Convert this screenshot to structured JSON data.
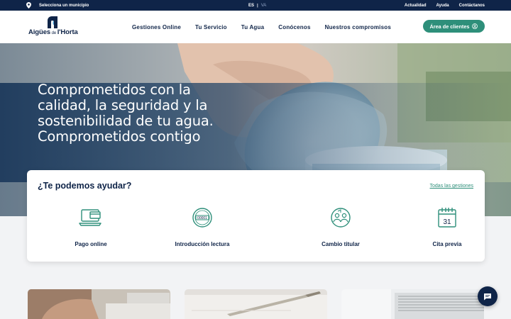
{
  "topbar": {
    "municipio": "Selecciona un municipio",
    "lang_active": "ES",
    "lang_separator": "|",
    "lang_other": "VA",
    "links": [
      "Actualidad",
      "Ayuda",
      "Contáctanos"
    ]
  },
  "logo": {
    "brand_main": "Aigües",
    "brand_small": " de ",
    "brand_end": "l'Horta"
  },
  "nav": [
    "Gestiones Online",
    "Tu Servicio",
    "Tu Agua",
    "Conócenos",
    "Nuestros compromisos"
  ],
  "client_button": "Área de clientes",
  "hero": {
    "lines": [
      "Comprometidos con la",
      "calidad, la seguridad y la",
      "sostenibilidad de tu agua.",
      "Comprometidos contigo"
    ]
  },
  "help": {
    "title": "¿Te podemos ayudar?",
    "all_link": "Todas las gestiones",
    "actions": [
      {
        "label": "Pago online",
        "icon": "laptop-card-icon"
      },
      {
        "label": "Introducción lectura",
        "icon": "water-meter-icon",
        "meter_text": "00001"
      },
      {
        "label": "Cambio titular",
        "icon": "user-switch-icon"
      },
      {
        "label": "Cita previa",
        "icon": "calendar-icon",
        "calendar_day": "31"
      }
    ]
  },
  "colors": {
    "navy": "#0f2448",
    "green": "#2e8f7a",
    "light_bg": "#f2f3f5"
  },
  "chat_icon": "chat-bubble-icon"
}
